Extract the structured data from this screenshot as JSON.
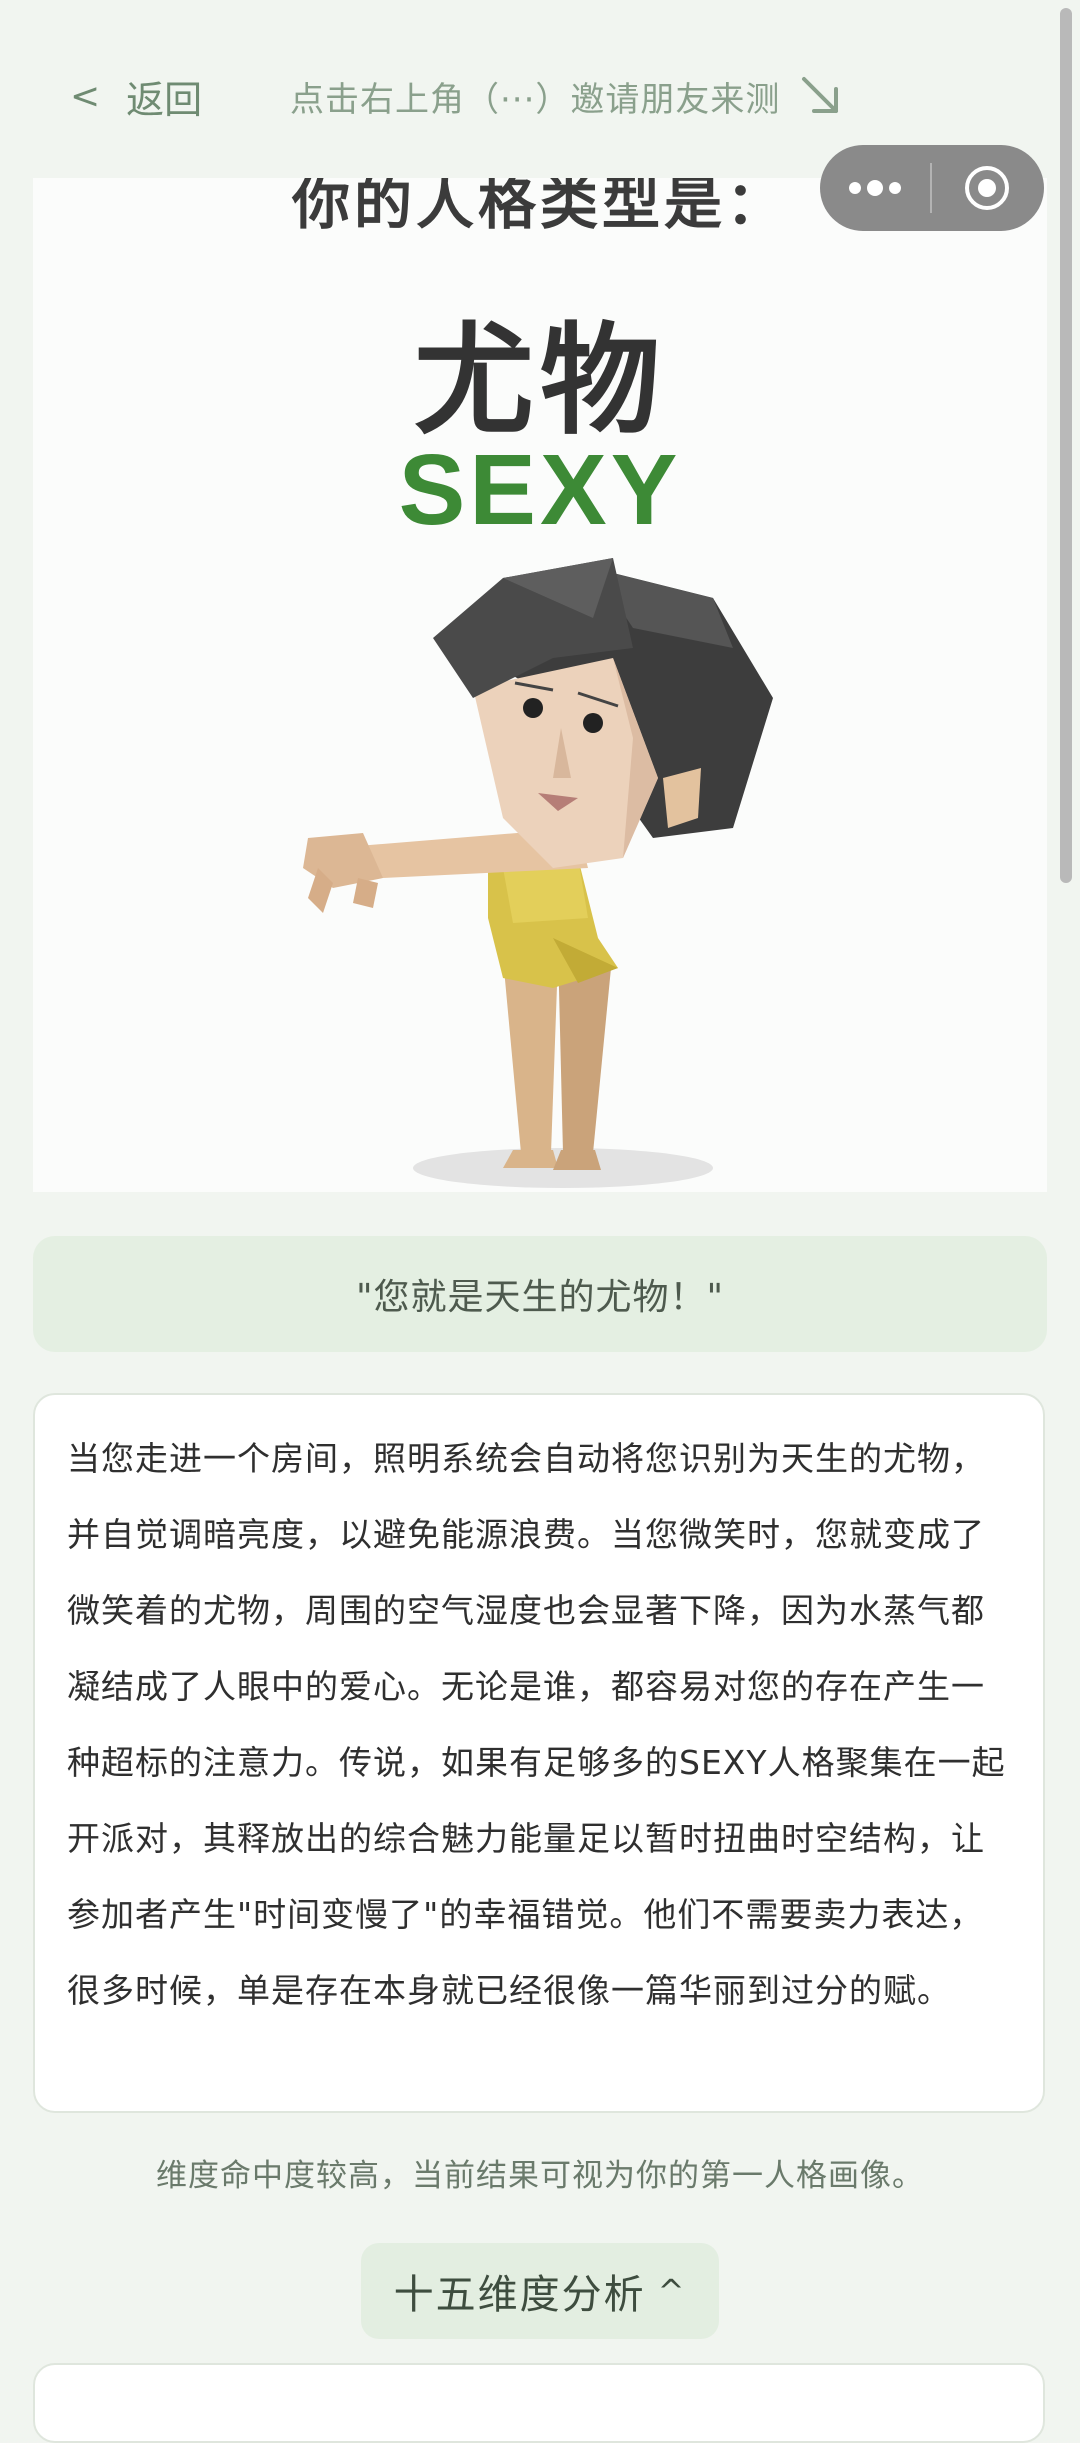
{
  "header": {
    "back_icon": "chevron-left-icon",
    "back_chevron": "<",
    "back_label": "返回",
    "share_hint": "点击右上角（···）邀请朋友来测",
    "share_arrow_icon": "arrow-down-right-icon"
  },
  "capsule": {
    "more_icon": "more-dots-icon",
    "close_icon": "target-circle-icon"
  },
  "result": {
    "heading": "你的人格类型是：",
    "type_cn": "尤物",
    "type_en": "SEXY"
  },
  "quote": "\"您就是天生的尤物！\"",
  "description": "当您走进一个房间，照明系统会自动将您识别为天生的尤物，并自觉调暗亮度，以避免能源浪费。当您微笑时，您就变成了微笑着的尤物，周围的空气湿度也会显著下降，因为水蒸气都凝结成了人眼中的爱心。无论是谁，都容易对您的存在产生一种超标的注意力。传说，如果有足够多的SEXY人格聚集在一起开派对，其释放出的综合魅力能量足以暂时扭曲时空结构，让参加者产生\"时间变慢了\"的幸福错觉。他们不需要卖力表达，很多时候，单是存在本身就已经很像一篇华丽到过分的赋。",
  "note": "维度命中度较高，当前结果可视为你的第一人格画像。",
  "analysis_button": {
    "label": "十五维度分析",
    "caret": "^"
  },
  "colors": {
    "background": "#f1f5f0",
    "accent_green": "#3d8a36",
    "quote_bg": "#e4efe2"
  }
}
